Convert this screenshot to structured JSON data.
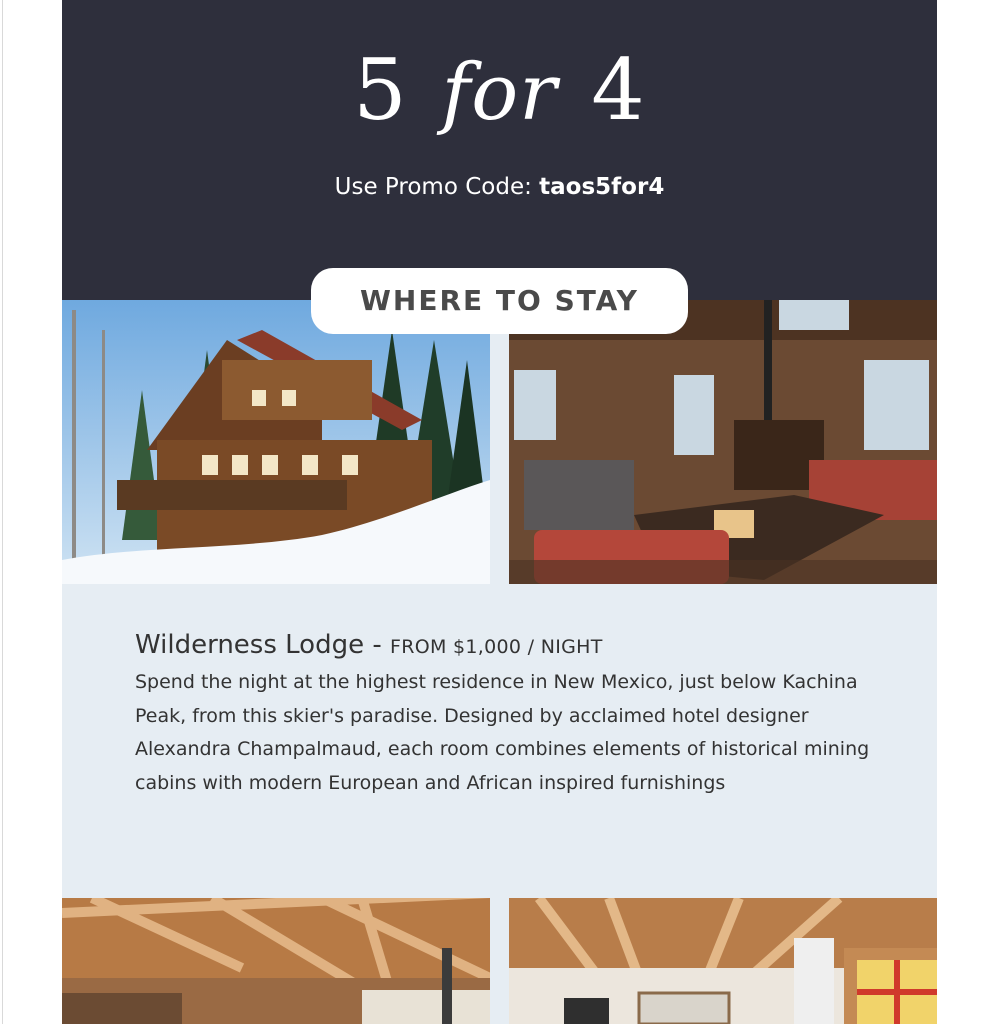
{
  "hero": {
    "title_num1": "5",
    "title_for": "for",
    "title_num2": "4",
    "promo_label": "Use Promo Code:",
    "promo_code": "taos5for4"
  },
  "section": {
    "label": "WHERE TO STAY"
  },
  "listing": {
    "name": "Wilderness Lodge",
    "separator": " - ",
    "price": "FROM $1,000 / NIGHT",
    "description": "Spend the night at the highest residence in New Mexico, just below Kachina Peak, from this skier's paradise. Designed by acclaimed hotel designer Alexandra Champalmaud, each room combines elements of historical mining cabins with modern European and African inspired furnishings"
  },
  "photos": {
    "lodge_exterior": "lodge-exterior-photo",
    "lodge_interior": "lodge-living-room-photo",
    "next_interior_left": "wood-ceiling-interior-photo",
    "next_interior_right": "wood-ceiling-room-photo"
  },
  "colors": {
    "hero_bg": "#2e2f3c",
    "panel_bg": "#e6edf3",
    "text": "#333333",
    "pill_bg": "#ffffff"
  }
}
